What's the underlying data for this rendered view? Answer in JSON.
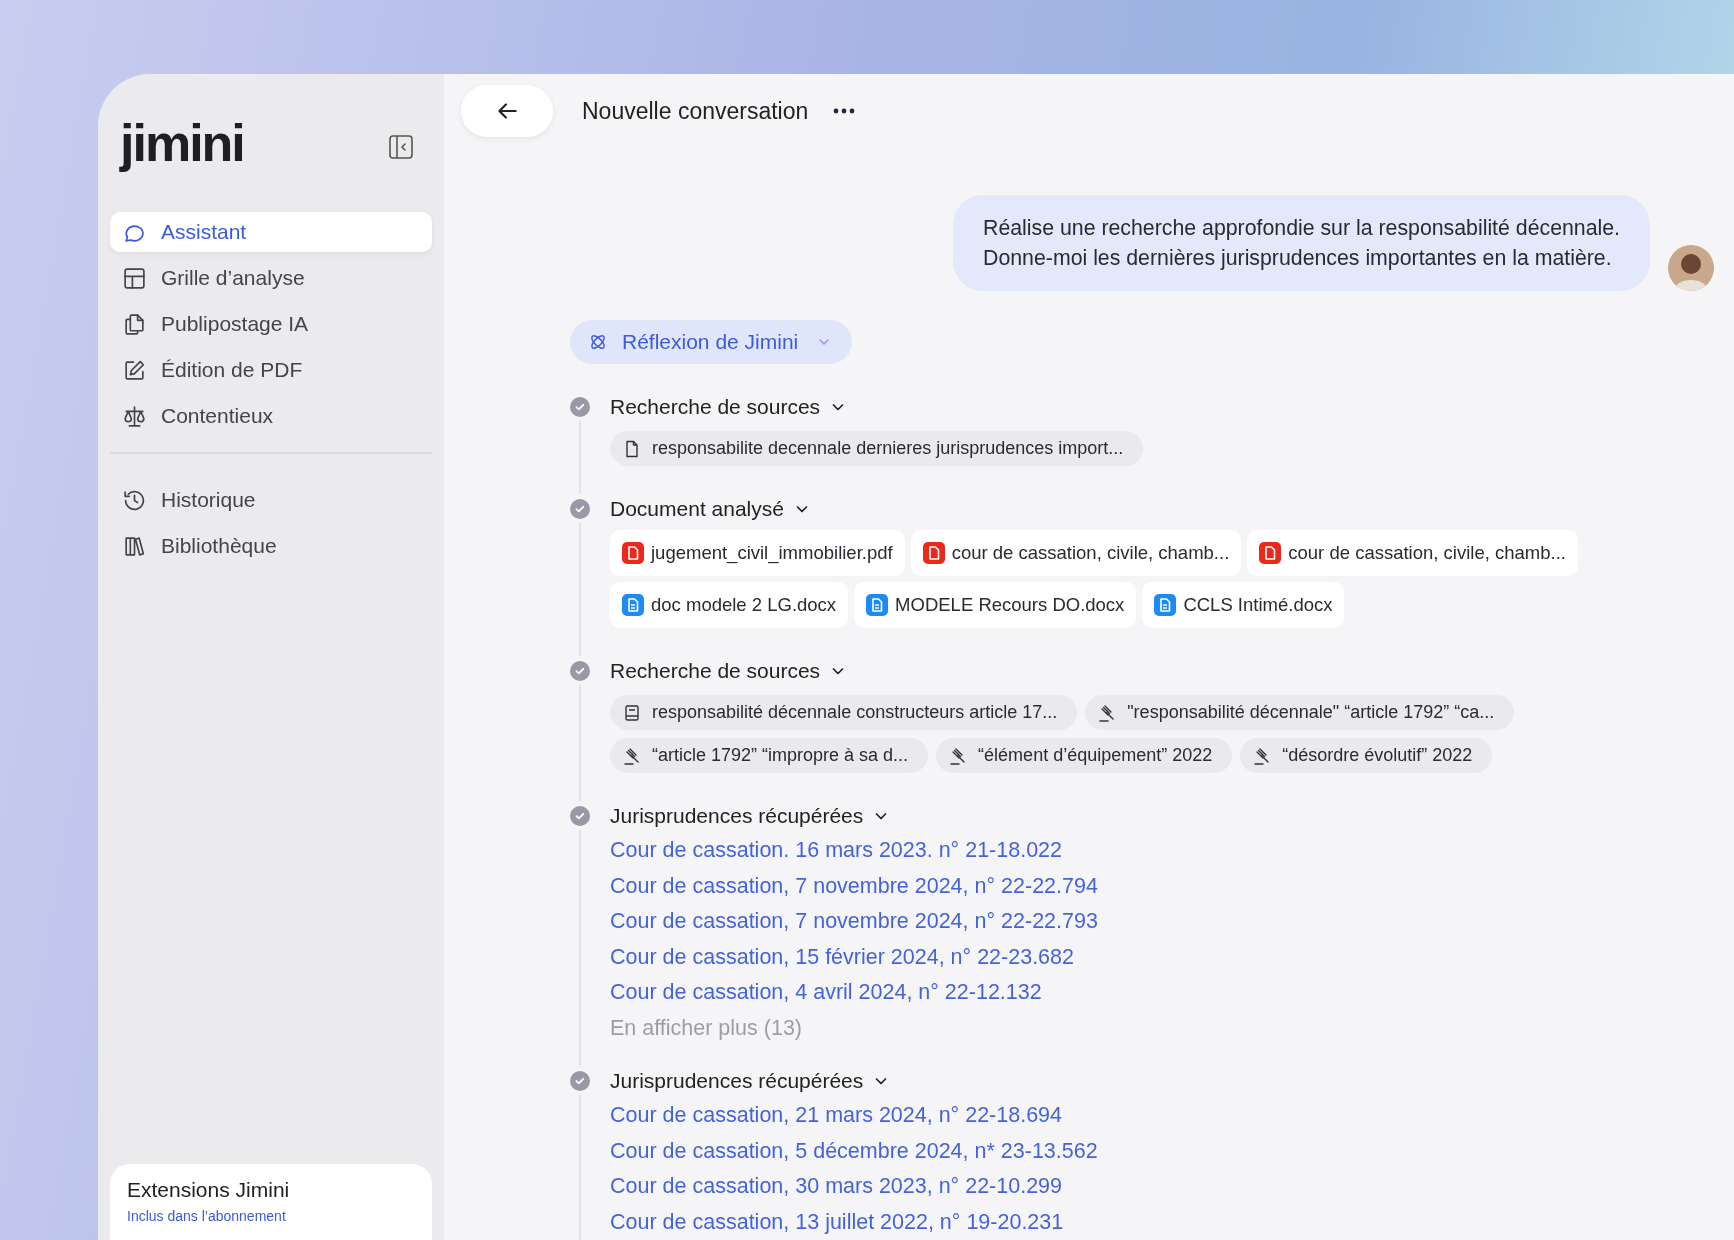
{
  "logo": "jimini",
  "sidebar": {
    "nav": [
      {
        "label": "Assistant",
        "selected": true
      },
      {
        "label": "Grille d’analyse",
        "selected": false
      },
      {
        "label": "Publipostage IA",
        "selected": false
      },
      {
        "label": "Édition de PDF",
        "selected": false
      },
      {
        "label": "Contentieux",
        "selected": false
      }
    ],
    "secondary": [
      {
        "label": "Historique",
        "selected": false
      },
      {
        "label": "Bibliothèque",
        "selected": false
      }
    ],
    "extensions_card": {
      "title": "Extensions Jimini",
      "subtitle": "Inclus dans l’abonnement"
    }
  },
  "header": {
    "title": "Nouvelle conversation"
  },
  "user_message": {
    "text": "Réalise une recherche approfondie sur la responsabilité décennale.\nDonne-moi les dernières jurisprudences importantes en la matière."
  },
  "reasoning": {
    "label": "Réflexion de Jimini",
    "expanded": false
  },
  "steps": [
    {
      "title": "Recherche de sources",
      "done": true,
      "expanded": true,
      "kind": "sources",
      "chips": [
        {
          "label": "responsabilite decennale dernieres jurisprudences import...",
          "kind": "file"
        }
      ]
    },
    {
      "title": "Document analysé",
      "done": true,
      "expanded": true,
      "kind": "documents",
      "chips": [
        {
          "label": "jugement_civil_immobilier.pdf",
          "kind": "pdf"
        },
        {
          "label": "cour de cassation, civile, chamb...",
          "kind": "pdf"
        },
        {
          "label": "cour de cassation, civile, chamb...",
          "kind": "pdf"
        },
        {
          "label": "doc modele 2 LG.docx",
          "kind": "docx"
        },
        {
          "label": "MODELE Recours DO.docx",
          "kind": "docx"
        },
        {
          "label": "CCLS Intimé.docx",
          "kind": "docx"
        }
      ]
    },
    {
      "title": "Recherche de sources",
      "done": true,
      "expanded": true,
      "kind": "sources",
      "chips": [
        {
          "label": "responsabilité décennale constructeurs article 17...",
          "kind": "book"
        },
        {
          "label": "\"responsabilité décennale\" “article 1792” “ca...",
          "kind": "gavel"
        },
        {
          "label": "“article 1792” “impropre à sa d...",
          "kind": "gavel"
        },
        {
          "label": "“élément d’équipement” 2022",
          "kind": "gavel"
        },
        {
          "label": "“désordre évolutif” 2022",
          "kind": "gavel"
        }
      ]
    },
    {
      "title": "Jurisprudences récupérées",
      "done": true,
      "expanded": true,
      "kind": "links",
      "links": [
        "Cour de cassation. 16 mars 2023. n° 21-18.022",
        "Cour de cassation, 7 novembre 2024, n° 22-22.794",
        "Cour de cassation, 7 novembre 2024, n° 22-22.793",
        "Cour de cassation, 15 février 2024, n° 22-23.682",
        "Cour de cassation, 4 avril 2024, n° 22-12.132"
      ],
      "more": "En afficher plus (13)"
    },
    {
      "title": "Jurisprudences récupérées",
      "done": true,
      "expanded": true,
      "kind": "links",
      "links": [
        "Cour de cassation, 21 mars 2024, n° 22-18.694",
        "Cour de cassation, 5 décembre 2024, n* 23-13.562",
        "Cour de cassation, 30 mars 2023, n° 22-10.299",
        "Cour de cassation, 13 juillet 2022, n° 19-20.231"
      ]
    }
  ]
}
